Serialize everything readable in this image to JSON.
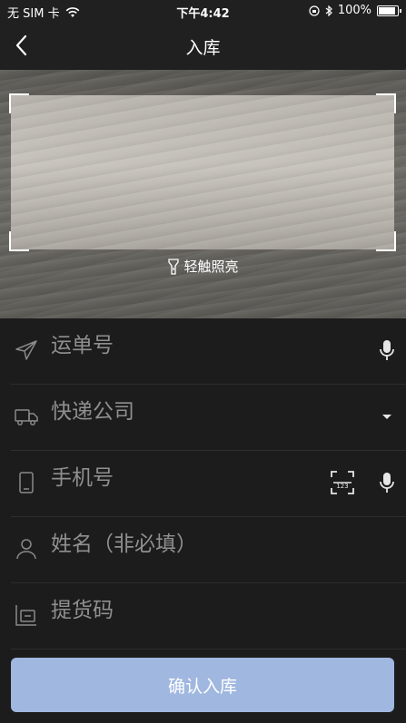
{
  "status": {
    "carrier": "无 SIM 卡",
    "time": "下午4:42",
    "battery": "100%",
    "battery_level": 1.0
  },
  "nav": {
    "title": "入库"
  },
  "camera": {
    "torch_label": "轻触照亮"
  },
  "form": {
    "waybill_placeholder": "运单号",
    "courier_placeholder": "快递公司",
    "phone_placeholder": "手机号",
    "name_placeholder": "姓名（非必填）",
    "pickup_placeholder": "提货码"
  },
  "confirm_label": "确认入库",
  "colors": {
    "accent_disabled": "#a0b7e0",
    "background": "#1c1c1c"
  }
}
